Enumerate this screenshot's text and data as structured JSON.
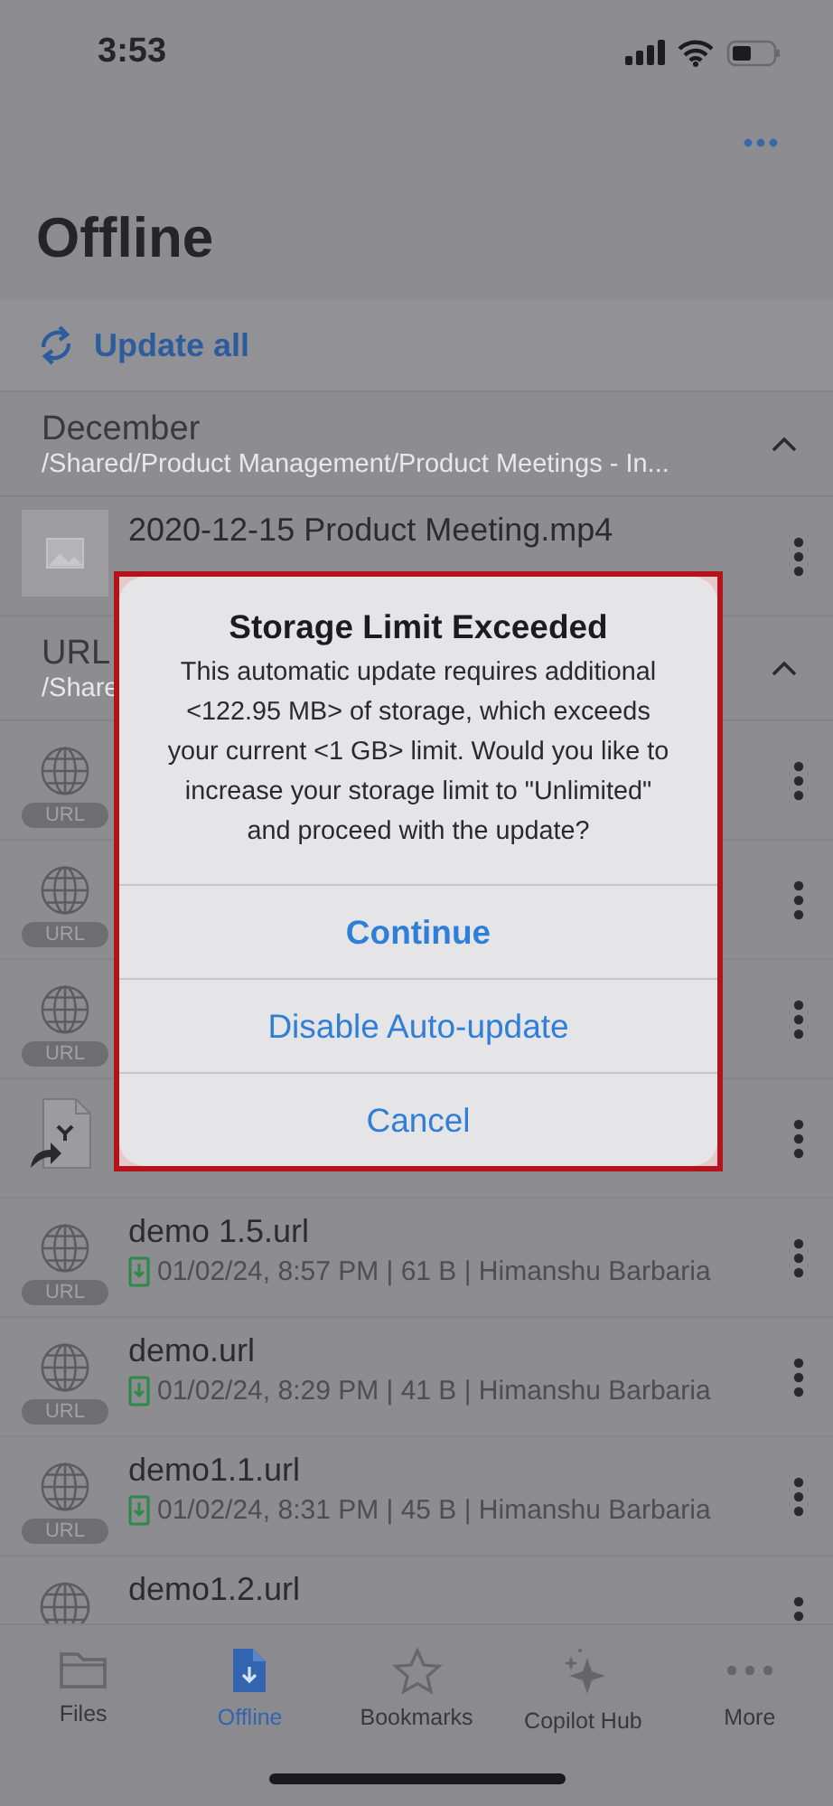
{
  "status_bar": {
    "time": "3:53"
  },
  "header": {
    "title": "Offline",
    "update_all": "Update all"
  },
  "sections": [
    {
      "title": "December",
      "path": "/Shared/Product Management/Product Meetings - In...",
      "expanded": true,
      "items": [
        {
          "kind": "video",
          "name": "2020-12-15 Product Meeting.mp4"
        }
      ]
    },
    {
      "title": "URL",
      "path": "/Share",
      "expanded": true,
      "items": [
        {
          "kind": "url",
          "badge": "URL"
        },
        {
          "kind": "url",
          "badge": "URL"
        },
        {
          "kind": "url",
          "badge": "URL"
        },
        {
          "kind": "shortcut"
        },
        {
          "kind": "url",
          "badge": "URL",
          "name": "demo 1.5.url",
          "meta": "01/02/24, 8:57 PM | 61 B | Himanshu Barbaria"
        },
        {
          "kind": "url",
          "badge": "URL",
          "name": "demo.url",
          "meta": "01/02/24, 8:29 PM | 41 B | Himanshu Barbaria"
        },
        {
          "kind": "url",
          "badge": "URL",
          "name": "demo1.1.url",
          "meta": "01/02/24, 8:31 PM | 45 B | Himanshu Barbaria"
        },
        {
          "kind": "url",
          "name": "demo1.2.url"
        }
      ]
    }
  ],
  "dialog": {
    "title": "Storage Limit Exceeded",
    "message": "This automatic update requires additional <122.95 MB> of storage, which exceeds your current <1 GB> limit. Would you like to increase your storage limit to \"Unlimited\" and proceed with the update?",
    "buttons": [
      {
        "label": "Continue",
        "bold": true
      },
      {
        "label": "Disable Auto-update",
        "bold": false
      },
      {
        "label": "Cancel",
        "bold": false
      }
    ]
  },
  "tab_bar": [
    {
      "kind": "files",
      "label": "Files",
      "selected": false
    },
    {
      "kind": "offline",
      "label": "Offline",
      "selected": true
    },
    {
      "kind": "bookmarks",
      "label": "Bookmarks",
      "selected": false
    },
    {
      "kind": "copilot",
      "label": "Copilot Hub",
      "selected": false
    },
    {
      "kind": "more",
      "label": "More",
      "selected": false
    }
  ]
}
